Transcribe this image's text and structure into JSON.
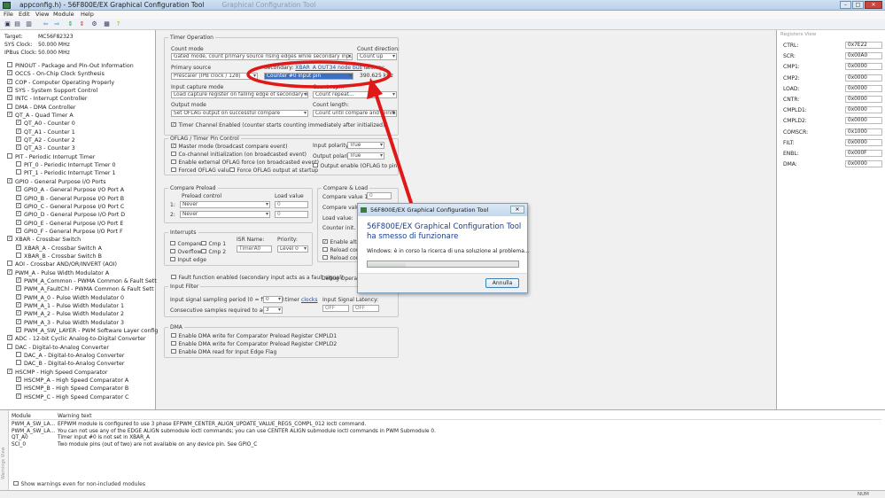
{
  "window": {
    "title": "appconfig.h) - 56F800E/EX Graphical Configuration Tool",
    "title_faded": "Graphical Configuration Tool",
    "minimize": "–",
    "maximize": "□",
    "close": "✕"
  },
  "menu": [
    "File",
    "Edit",
    "View",
    "Module",
    "Help"
  ],
  "toolbar_icons": [
    "save-icon",
    "save-all-icon",
    "print-icon",
    "back-icon",
    "forward-icon",
    "move-up-icon",
    "move-down-icon",
    "settings-icon",
    "grid-icon",
    "help-icon"
  ],
  "target_info": [
    {
      "label": "Target:",
      "value": "MC56F82323"
    },
    {
      "label": "SYS Clock:",
      "value": "50.000 MHz"
    },
    {
      "label": "IPBus Clock:",
      "value": "50.000 MHz"
    }
  ],
  "tree": [
    {
      "label": "PINOUT - Package and Pin-Out Information",
      "indent": 0,
      "checked": false
    },
    {
      "label": "OCCS - On-Chip Clock Synthesis",
      "indent": 0,
      "checked": true
    },
    {
      "label": "COP - Computer Operating Properly",
      "indent": 0,
      "checked": true
    },
    {
      "label": "SYS - System Support Control",
      "indent": 0,
      "checked": true
    },
    {
      "label": "INTC - Interrupt Controller",
      "indent": 0,
      "checked": true
    },
    {
      "label": "DMA - DMA Controller",
      "indent": 0,
      "checked": false
    },
    {
      "label": "QT_A - Quad Timer A",
      "indent": 0,
      "checked": true
    },
    {
      "label": "QT_A0 - Counter 0",
      "indent": 1,
      "checked": true
    },
    {
      "label": "QT_A1 - Counter 1",
      "indent": 1,
      "checked": true
    },
    {
      "label": "QT_A2 - Counter 2",
      "indent": 1,
      "checked": true
    },
    {
      "label": "QT_A3 - Counter 3",
      "indent": 1,
      "checked": true
    },
    {
      "label": "PIT - Periodic Interrupt Timer",
      "indent": 0,
      "checked": false
    },
    {
      "label": "PIT_0 - Periodic Interrupt Timer 0",
      "indent": 1,
      "checked": false
    },
    {
      "label": "PIT_1 - Periodic Interrupt Timer 1",
      "indent": 1,
      "checked": false
    },
    {
      "label": "GPIO - General Purpose I/O Ports",
      "indent": 0,
      "checked": true
    },
    {
      "label": "GPIO_A - General Purpose I/O Port A",
      "indent": 1,
      "checked": true
    },
    {
      "label": "GPIO_B - General Purpose I/O Port B",
      "indent": 1,
      "checked": true
    },
    {
      "label": "GPIO_C - General Purpose I/O Port C",
      "indent": 1,
      "checked": true
    },
    {
      "label": "GPIO_D - General Purpose I/O Port D",
      "indent": 1,
      "checked": true
    },
    {
      "label": "GPIO_E - General Purpose I/O Port E",
      "indent": 1,
      "checked": true
    },
    {
      "label": "GPIO_F - General Purpose I/O Port F",
      "indent": 1,
      "checked": true
    },
    {
      "label": "XBAR - Crossbar Switch",
      "indent": 0,
      "checked": true
    },
    {
      "label": "XBAR_A - Crossbar Switch A",
      "indent": 1,
      "checked": true
    },
    {
      "label": "XBAR_B - Crossbar Switch B",
      "indent": 1,
      "checked": false
    },
    {
      "label": "AOI - Crossbar AND/OR/INVERT (AOI)",
      "indent": 0,
      "checked": false
    },
    {
      "label": "PWM_A - Pulse Width Modulator A",
      "indent": 0,
      "checked": true
    },
    {
      "label": "PWM_A_Common - PWMA Common & Fault Sett",
      "indent": 1,
      "checked": true
    },
    {
      "label": "PWM_A_FaultChl - PWMA Common & Fault Sett",
      "indent": 1,
      "checked": true
    },
    {
      "label": "PWM_A_0 - Pulse Width Modulator 0",
      "indent": 1,
      "checked": true
    },
    {
      "label": "PWM_A_1 - Pulse Width Modulator 1",
      "indent": 1,
      "checked": true
    },
    {
      "label": "PWM_A_2 - Pulse Width Modulator 2",
      "indent": 1,
      "checked": true
    },
    {
      "label": "PWM_A_3 - Pulse Width Modulator 3",
      "indent": 1,
      "checked": true
    },
    {
      "label": "PWM_A_SW_LAYER - PWM Software Layer config",
      "indent": 1,
      "checked": true
    },
    {
      "label": "ADC - 12-bit Cyclic Analog-to-Digital Converter",
      "indent": 0,
      "checked": true
    },
    {
      "label": "DAC - Digital-to-Analog Converter",
      "indent": 0,
      "checked": false
    },
    {
      "label": "DAC_A - Digital-to-Analog Converter",
      "indent": 1,
      "checked": false
    },
    {
      "label": "DAC_B - Digital-to-Analog Converter",
      "indent": 1,
      "checked": false
    },
    {
      "label": "HSCMP - High Speed Comparator",
      "indent": 0,
      "checked": true
    },
    {
      "label": "HSCMP_A - High Speed Comparator A",
      "indent": 1,
      "checked": true
    },
    {
      "label": "HSCMP_B - High Speed Comparator B",
      "indent": 1,
      "checked": true
    },
    {
      "label": "HSCMP_C - High Speed Comparator C",
      "indent": 1,
      "checked": true
    }
  ],
  "timer": {
    "group_title": "Timer Operation",
    "count_mode_label": "Count mode",
    "count_mode_value": "Gated mode, count primary source rising edges while secondary input high",
    "count_direction_label": "Count direction:",
    "count_direction_value": "Count up",
    "primary_source_label": "Primary source",
    "primary_source_value": "Prescaler (IPB clock / 128)",
    "secondary_label": "Secondary:",
    "secondary_link": "XBAR_A OUT34 node bus",
    "secondary_suffix": "latency:",
    "secondary_value": "Counter #0 input pin",
    "frequency_value": "390.625 kHz",
    "input_capture_label": "Input capture mode",
    "input_capture_value": "Load capture register on falling edge of secondary input",
    "count_repeat_label": "Count rep...",
    "count_repeat_value": "Count repeat...",
    "output_mode_label": "Output mode",
    "output_mode_value": "Set OFLAG output on successful compare",
    "count_length_label": "Count length:",
    "count_length_value": "Count until compare and reinitialize",
    "enabled_label": "Timer Channel Enabled (counter starts counting immediately after initialized)"
  },
  "oflag": {
    "group_title": "OFLAG / Timer Pin Control",
    "master_label": "Master mode (broadcast compare event)",
    "cochannel_label": "Co-channel initialization (on broadcasted event)",
    "external_label": "Enable external OFLAG force (on broadcasted event)",
    "forced_label": "Forced OFLAG value",
    "force_label": "Force OFLAG output at startup",
    "input_polarity_label": "Input polarity",
    "input_polarity_value": "True",
    "output_polarity_label": "Output polarity",
    "output_polarity_value": "True",
    "output_enable_label": "Output enable (OFLAG to pin)"
  },
  "compare_preload": {
    "group_title": "Compare Preload",
    "preload_control_label": "Preload control",
    "load_value_label": "Load value",
    "row1_label": "1:",
    "row1_value": "Never",
    "row1_load": "0",
    "row2_label": "2:",
    "row2_value": "Never",
    "row2_load": "0"
  },
  "compare_load": {
    "group_title": "Compare & Load",
    "compare1_label": "Compare value 1:",
    "compare1_value": "0",
    "compare2_label": "Compare value 2:",
    "load_value_label": "Load value:",
    "counter_init_label": "Counter init. value:",
    "enable_label": "Enable alternating",
    "reload1_label": "Reload cou...",
    "reload2_label": "Reload cou..."
  },
  "interrupts": {
    "group_title": "Interrupts",
    "compare_label": "Compare",
    "cmp1_label": "Cmp 1",
    "overflow_label": "Overflow",
    "cmp2_label": "Cmp 2",
    "input_edge_label": "Input edge",
    "isr_name_label": "ISR Name:",
    "isr_name_value": "TimerA0",
    "priority_label": "Priority:",
    "priority_value": "Level 0",
    "fault_label": "Fault function enabled (secondary input acts as a fault signal)",
    "debug_label": "Debug Operation"
  },
  "input_filter": {
    "group_title": "Input Filter",
    "sampling_label": "Input signal sampling period (0 = filter off):",
    "sampling_value": "0",
    "timer_label": "timer",
    "clocks_label": "clocks",
    "consecutive_label": "Consecutive samples required to agree:",
    "consecutive_value": "3",
    "latency_label": "Input Signal Latency:",
    "latency_value1": "OFF",
    "latency_value2": "OFF"
  },
  "dma": {
    "group_title": "DMA",
    "item1": "Enable DMA write for Comparator Preload Register CMPLD1",
    "item2": "Enable DMA write for Comparator Preload Register CMPLD2",
    "item3": "Enable DMA read for Input Edge Flag"
  },
  "registers": {
    "title": "Registers View",
    "rows": [
      {
        "name": "CTRL:",
        "value": "0x7E22"
      },
      {
        "name": "SCR:",
        "value": "0x00A0"
      },
      {
        "name": "CMP1:",
        "value": "0x0000"
      },
      {
        "name": "CMP2:",
        "value": "0x0000"
      },
      {
        "name": "LOAD:",
        "value": "0x0000"
      },
      {
        "name": "CNTR:",
        "value": "0x0000"
      },
      {
        "name": "CMPLD1:",
        "value": "0x0000"
      },
      {
        "name": "CMPLD2:",
        "value": "0x0000"
      },
      {
        "name": "COMSCR:",
        "value": "0x1000"
      },
      {
        "name": "FILT:",
        "value": "0x0000"
      },
      {
        "name": "ENBL:",
        "value": "0x000F"
      },
      {
        "name": "DMA:",
        "value": "0x0000"
      }
    ]
  },
  "warnings": {
    "col_module": "Module",
    "col_warning": "Warning text",
    "side_label": "Warnings View",
    "rows": [
      {
        "module": "PWM_A_SW_LA...",
        "text": "EFPWM module is configured to use 3 phase EFPWM_CENTER_ALIGN_UPDATE_VALUE_REGS_COMPL_012 ioctl command."
      },
      {
        "module": "PWM_A_SW_LA...",
        "text": "You can not use any of the EDGE ALIGN submodule ioctl commands; you can use CENTER ALIGN submodule ioctl commands in PWM Submodule 0."
      },
      {
        "module": "QT_A0",
        "text": "Timer input #0 is not set in XBAR_A"
      },
      {
        "module": "SCI_0",
        "text": "Two module pins (out of two) are not available on any device pin. See GPIO_C"
      }
    ],
    "show_label": "Show warnings even for non-included modules"
  },
  "status": {
    "num": "NUM"
  },
  "dialog": {
    "title": "56F800E/EX Graphical Configuration Tool",
    "close": "✕",
    "heading": "56F800E/EX Graphical Configuration Tool ha smesso di funzionare",
    "message": "Windows: è in corso la ricerca di una soluzione al problema...",
    "progress": 0.25,
    "button": "Annulla"
  },
  "annotation": {
    "color": "#e01818"
  }
}
